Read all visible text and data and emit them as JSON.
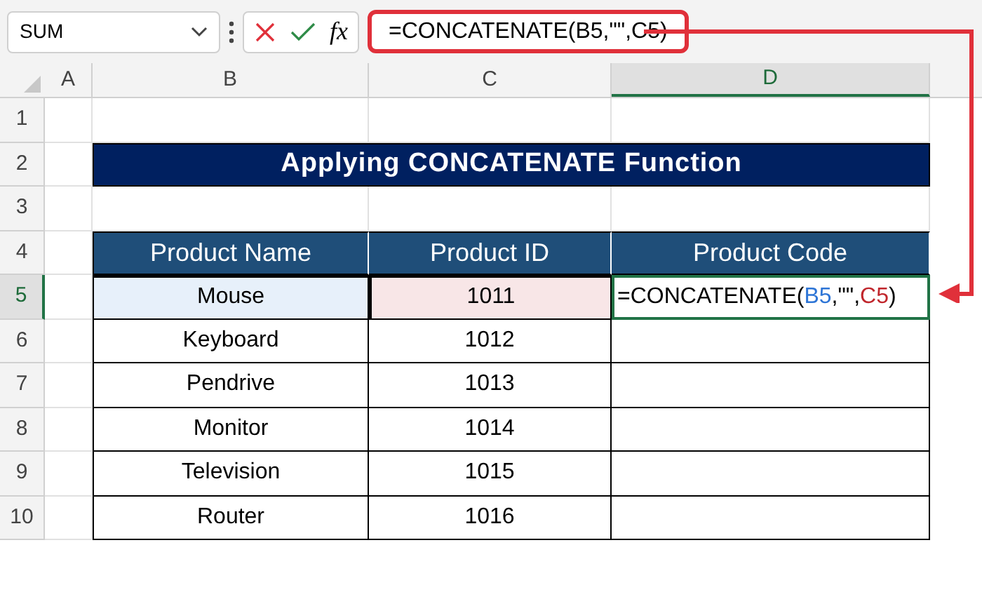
{
  "name_box": {
    "value": "SUM"
  },
  "formula_bar": {
    "fx": "fx",
    "formula": "=CONCATENATE(B5,\"\",C5)"
  },
  "column_headers": [
    {
      "label": "A",
      "selected": false
    },
    {
      "label": "B",
      "selected": false
    },
    {
      "label": "C",
      "selected": false
    },
    {
      "label": "D",
      "selected": true
    }
  ],
  "row_headers": [
    {
      "label": "1",
      "selected": false
    },
    {
      "label": "2",
      "selected": false
    },
    {
      "label": "3",
      "selected": false
    },
    {
      "label": "4",
      "selected": false
    },
    {
      "label": "5",
      "selected": true
    },
    {
      "label": "6",
      "selected": false
    },
    {
      "label": "7",
      "selected": false
    },
    {
      "label": "8",
      "selected": false
    },
    {
      "label": "9",
      "selected": false
    },
    {
      "label": "10",
      "selected": false
    }
  ],
  "title": "Applying CONCATENATE Function",
  "table": {
    "columns": [
      "Product Name",
      "Product ID",
      "Product Code"
    ],
    "rows": [
      {
        "name": "Mouse",
        "id": "1011",
        "editing": true,
        "formula_parts": [
          {
            "text": "=CONCATENATE(",
            "color": "#000000"
          },
          {
            "text": "B5",
            "color": "#2e75d6"
          },
          {
            "text": ",\"\",",
            "color": "#000000"
          },
          {
            "text": "C5",
            "color": "#c0262c"
          },
          {
            "text": ")",
            "color": "#000000"
          }
        ]
      },
      {
        "name": "Keyboard",
        "id": "1012",
        "editing": false
      },
      {
        "name": "Pendrive",
        "id": "1013",
        "editing": false
      },
      {
        "name": "Monitor",
        "id": "1014",
        "editing": false
      },
      {
        "name": "Television",
        "id": "1015",
        "editing": false
      },
      {
        "name": "Router",
        "id": "1016",
        "editing": false
      }
    ]
  }
}
